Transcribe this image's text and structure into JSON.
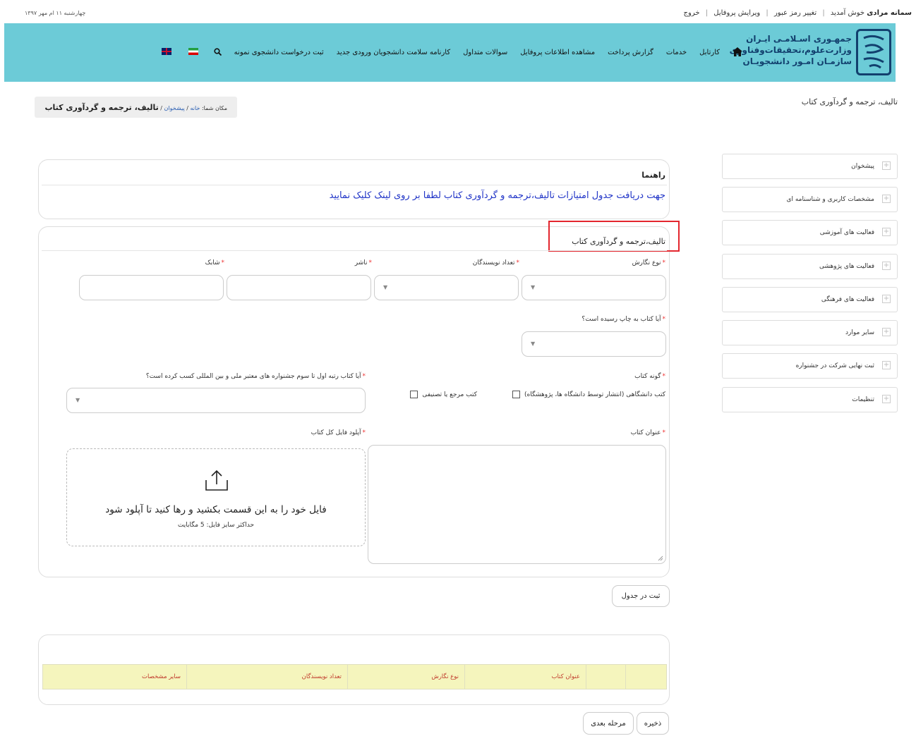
{
  "topbar": {
    "user_name": "سمانه مرادی",
    "welcome": "خوش آمدید",
    "change_password": "تغییر رمز عبور",
    "edit_profile": "ویرایش پروفایل",
    "logout": "خروج",
    "date": "چهارشنبه ۱۱ ام مهر ۱۳۹۷"
  },
  "logo": {
    "emblem_text": "امور دانشجویان",
    "line1": "جمهـوری اسـلامـی ایـران",
    "line2": "وزارت‌علوم،تحقیقات‌وفناوری",
    "line3": "سازمـان امـور دانشجویـان"
  },
  "nav": {
    "items": [
      "کارتابل",
      "خدمات",
      "گزارش پرداخت",
      "مشاهده اطلاعات پروفایل",
      "سوالات متداول",
      "کارنامه سلامت دانشجویان ورودی جدید",
      "ثبت درخواست دانشجوی نمونه"
    ],
    "search_icon": "search-icon",
    "home_icon": "home-icon"
  },
  "page": {
    "title": "تالیف، ترجمه و گردآوری کتاب"
  },
  "breadcrumb": {
    "prefix": "مکان شما:",
    "home": "خانه",
    "dashboard": "پیشخوان",
    "current": "تالیف، ترجمه و گردآوری کتاب"
  },
  "sidebar": {
    "items": [
      "پیشخوان",
      "مشخصات کاربری و شناسنامه ای",
      "فعالیت های آموزشی",
      "فعالیت های پژوهشی",
      "فعالیت های فرهنگی",
      "سایر موارد",
      "ثبت نهایی شرکت در جشنواره",
      "تنظیمات"
    ]
  },
  "guide": {
    "title": "راهنما",
    "link": "جهت دریافت جدول امتیازات تالیف،ترجمه و گردآوری کتاب لطفا بر روی لینک کلیک نمایید"
  },
  "form": {
    "title": "تالیف،ترجمه و گردآوری کتاب",
    "writing_type_label": "نوع نگارش",
    "authors_count_label": "تعداد نویسندگان",
    "publisher_label": "ناشر",
    "isbn_label": "شابک",
    "published_label": "آیا کتاب به چاپ رسیده است؟",
    "book_kind_label": "گونه کتاب",
    "rank_label": "آیا کتاب رتبه اول تا سوم جشنواره های معتبر ملی و بین المللی کسب کرده است؟",
    "kind_option1": "کتب دانشگاهی (انتشار توسط دانشگاه ها، پژوهشگاه)",
    "kind_option2": "کتب مرجع یا تصنیفی",
    "book_title_label": "عنوان کتاب",
    "upload_label": "آپلود فایل کل کتاب",
    "upload_message": "فایل خود را به این قسمت بکشید و رها کنید تا آپلود شود",
    "upload_limit": "حداکثر سایز فایل: 5 مگابایت",
    "submit_to_table": "ثبت در جدول"
  },
  "table": {
    "headers": [
      "",
      "",
      "عنوان کتاب",
      "نوع نگارش",
      "تعداد نویسندگان",
      "سایر مشخصات"
    ]
  },
  "footer": {
    "save": "ذخیره",
    "next_step": "مرحله بعدی"
  },
  "colors": {
    "header_bg": "#6ccbd7",
    "table_header_bg": "#f5f5bd",
    "highlight_box": "#e3262e",
    "link": "#1f33c7"
  }
}
